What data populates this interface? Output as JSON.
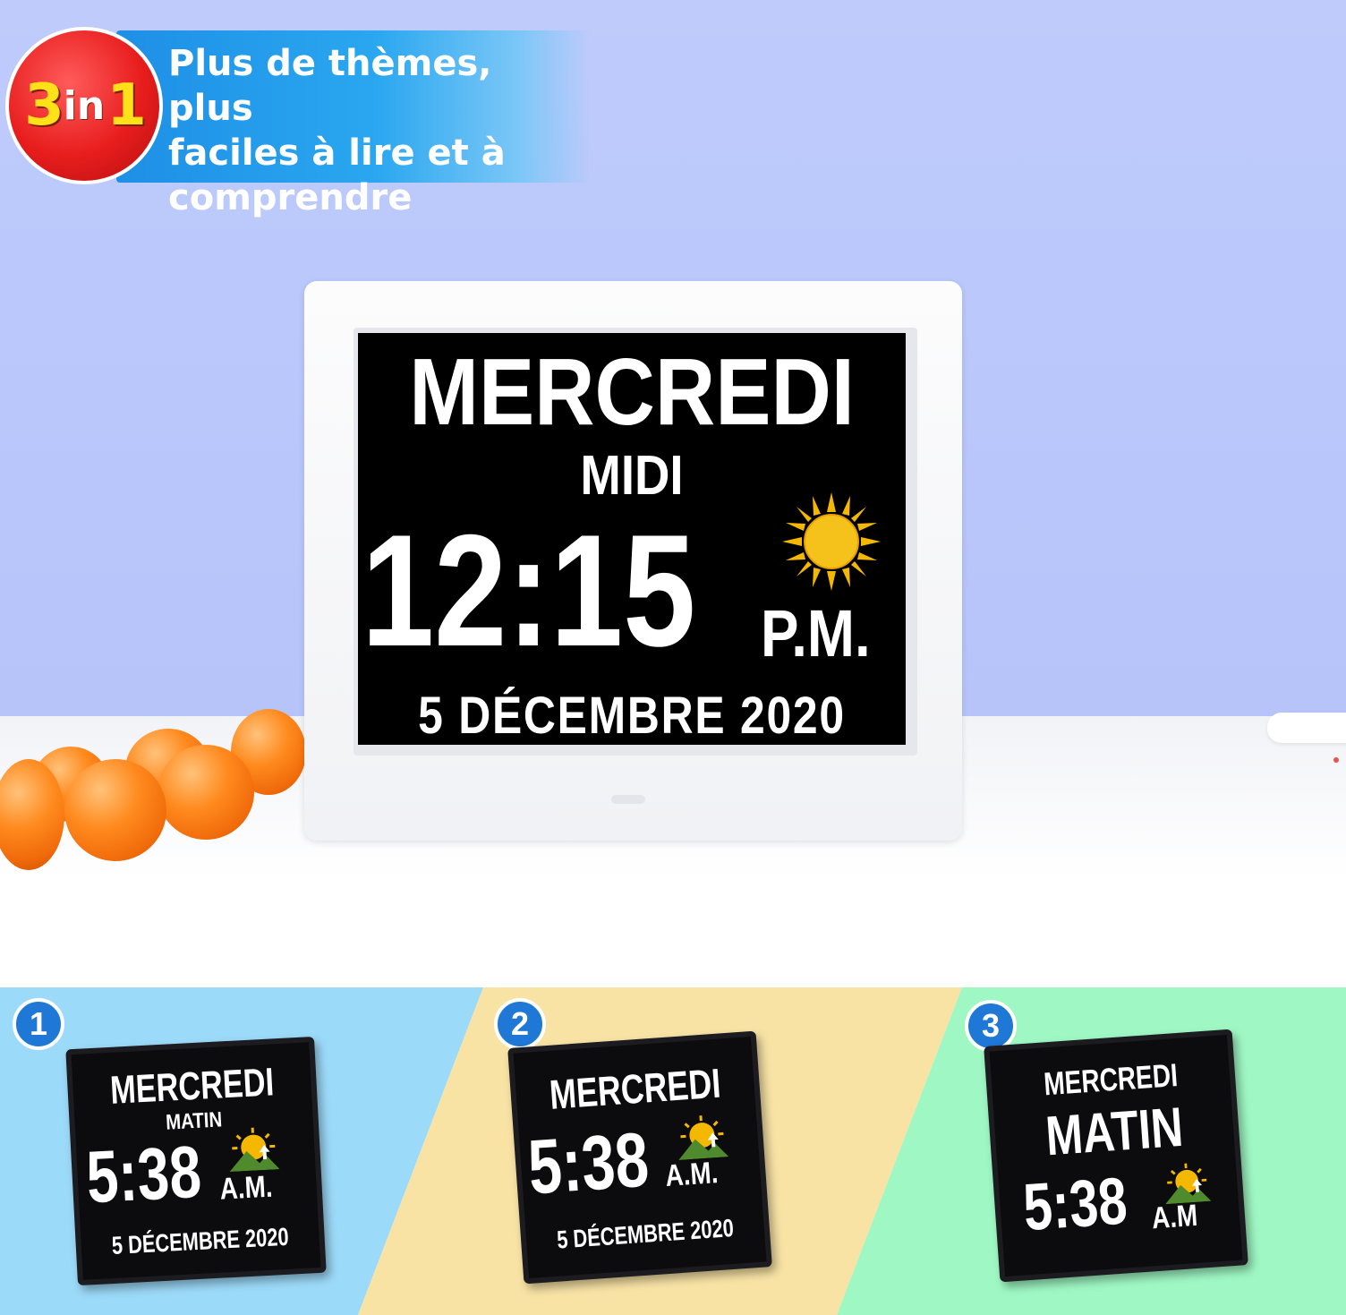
{
  "badge": {
    "big_three": "3",
    "in": "in",
    "big_one": "1",
    "line1": "Plus de thèmes, plus",
    "line2": "faciles à lire et à",
    "line3": "comprendre",
    "circle_color": "#e81d1d",
    "strip_color": "#1e8fe6"
  },
  "main_display": {
    "day": "MERCREDI",
    "period": "MIDI",
    "time": "12:15",
    "ampm": "P.M.",
    "date": "5  DÉCEMBRE  2020",
    "icon": "sun-icon"
  },
  "themes": [
    {
      "number": "1",
      "background": "#9cdaf9",
      "day": "MERCREDI",
      "period": "MATIN",
      "time": "5:38",
      "ampm": "A.M.",
      "date": "5 DÉCEMBRE  2020",
      "icon": "sunrise-icon"
    },
    {
      "number": "2",
      "background": "#f8e3a5",
      "day": "MERCREDI",
      "time": "5:38",
      "ampm": "A.M.",
      "date": "5 DÉCEMBRE  2020",
      "icon": "sunrise-icon"
    },
    {
      "number": "3",
      "background": "#9ff8c4",
      "day": "MERCREDI",
      "period": "MATIN",
      "time": "5:38",
      "ampm": "A.M",
      "icon": "sunrise-icon"
    }
  ]
}
